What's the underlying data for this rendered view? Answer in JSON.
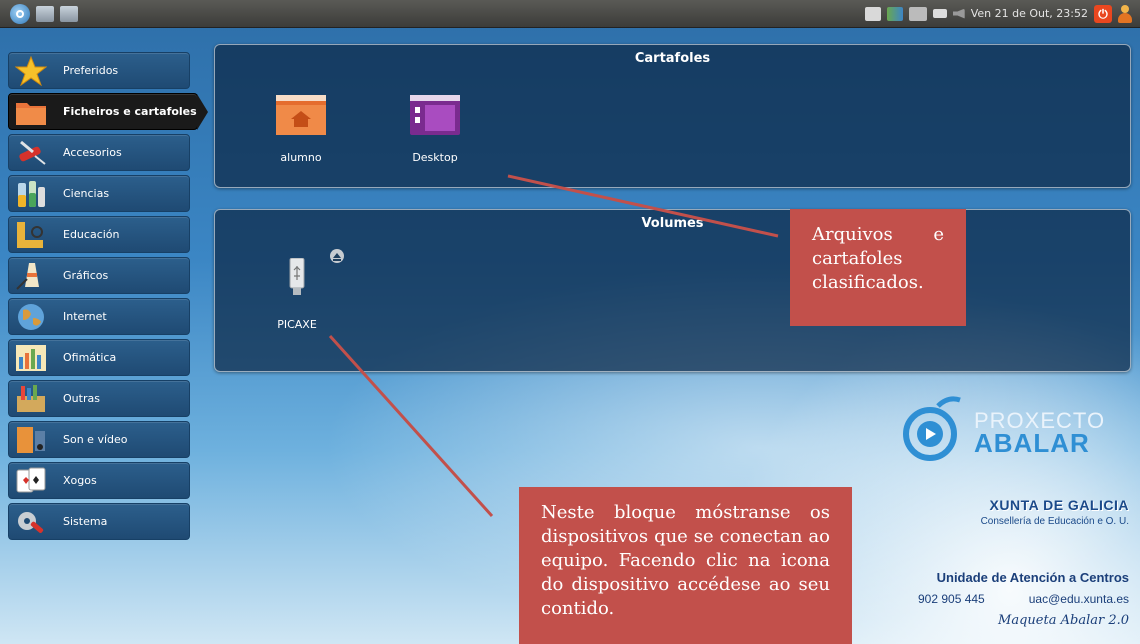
{
  "top_panel": {
    "clock": "Ven 21 de Out, 23:52"
  },
  "sidebar": {
    "items": [
      {
        "label": "Preferidos",
        "icon": "star-icon"
      },
      {
        "label": "Ficheiros e cartafoles",
        "icon": "folder-icon",
        "active": true
      },
      {
        "label": "Accesorios",
        "icon": "swiss-knife-icon"
      },
      {
        "label": "Ciencias",
        "icon": "flask-icon"
      },
      {
        "label": "Educación",
        "icon": "ruler-icon"
      },
      {
        "label": "Gráficos",
        "icon": "paintbrush-icon"
      },
      {
        "label": "Internet",
        "icon": "globe-icon"
      },
      {
        "label": "Ofimática",
        "icon": "office-icon"
      },
      {
        "label": "Outras",
        "icon": "misc-box-icon"
      },
      {
        "label": "Son e vídeo",
        "icon": "film-icon"
      },
      {
        "label": "Xogos",
        "icon": "cards-icon"
      },
      {
        "label": "Sistema",
        "icon": "tools-icon"
      }
    ]
  },
  "cartafoles": {
    "title": "Cartafoles",
    "items": [
      {
        "label": "alumno",
        "icon": "home-folder-icon"
      },
      {
        "label": "Desktop",
        "icon": "desktop-folder-icon"
      }
    ]
  },
  "volumes": {
    "title": "Volumes",
    "items": [
      {
        "label": "PICAXE",
        "icon": "usb-drive-icon"
      }
    ]
  },
  "notes": {
    "top": "Arquivos e cartafoles clasificados.",
    "bottom": "Neste bloque móstranse os dispositivos que se conectan ao equipo. Facendo clic na icona do dispositivo accédese ao seu contido."
  },
  "branding": {
    "proxecto": "PROXECTO",
    "abalar": "ABALAR",
    "xunta": "XUNTA DE GALICIA",
    "conselleria": "Consellería de Educación e O. U.",
    "unidade": "Unidade de Atención a Centros",
    "phone": "902 905 445",
    "email": "uac@edu.xunta.es",
    "maqueta": "Maqueta Abalar 2.0"
  },
  "colors": {
    "note_bg": "#c2504b",
    "panel_bg": "#0c2846",
    "accent_orange": "#e9471f"
  }
}
